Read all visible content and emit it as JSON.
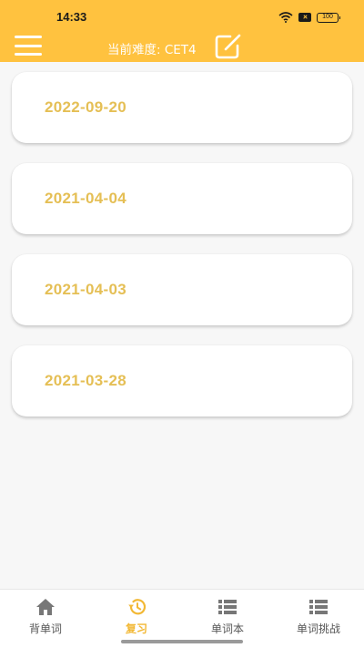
{
  "status_bar": {
    "time": "14:33",
    "battery": "100"
  },
  "toolbar": {
    "difficulty_label": "当前难度: CET4"
  },
  "review_dates": [
    "2022-09-20",
    "2021-04-04",
    "2021-04-03",
    "2021-03-28"
  ],
  "bottom_nav": {
    "items": [
      {
        "label": "背单词",
        "icon": "home-icon",
        "active": false
      },
      {
        "label": "复习",
        "icon": "history-icon",
        "active": true
      },
      {
        "label": "单词本",
        "icon": "list-icon",
        "active": false
      },
      {
        "label": "单词挑战",
        "icon": "list-icon",
        "active": false
      }
    ]
  },
  "colors": {
    "header": "#ffc23f",
    "date_text": "#e5bf55",
    "active_tab": "#f2b835",
    "inactive_tab": "#555555"
  }
}
